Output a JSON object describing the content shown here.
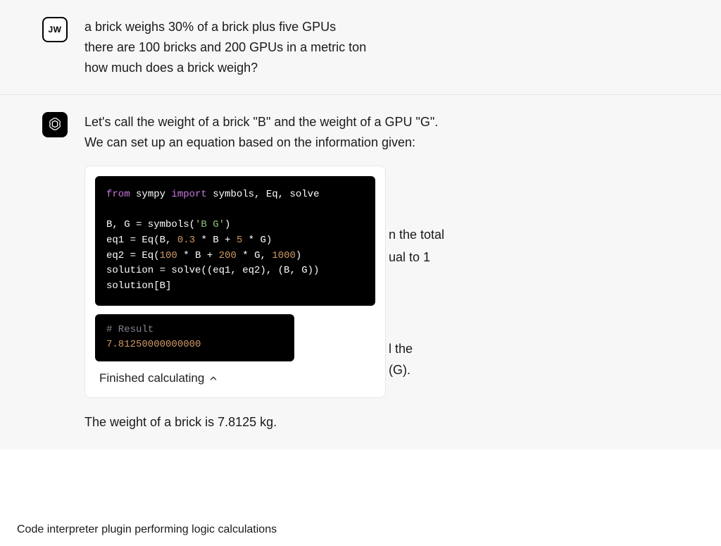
{
  "user": {
    "initials": "JW",
    "message_line1": "a brick weighs 30% of a brick plus five GPUs",
    "message_line2": "there are 100 bricks and 200 GPUs in a metric ton",
    "message_line3": "how much does a brick weigh?"
  },
  "assistant": {
    "intro": "Let's call the weight of a brick \"B\" and the weight of a GPU \"G\". We can set up an equation based on the information given:",
    "bg_fragments": {
      "f1": "n the total",
      "f2": "ual to 1",
      "f3": "l the",
      "f4": " (G)."
    },
    "code": {
      "kw_from": "from",
      "mod": " sympy ",
      "kw_import": "import",
      "imports": " symbols, Eq, solve",
      "line2a": "B, G = symbols(",
      "line2_str": "'B G'",
      "line2b": ")",
      "line3a": "eq1 = Eq(B, ",
      "n03": "0.3",
      "line3b": " * B + ",
      "n5": "5",
      "line3c": " * G)",
      "line4a": "eq2 = Eq(",
      "n100": "100",
      "line4b": " * B + ",
      "n200": "200",
      "line4c": " * G, ",
      "n1000": "1000",
      "line4d": ")",
      "line5": "solution = solve((eq1, eq2), (B, G))",
      "line6": "solution[B]"
    },
    "result": {
      "comment": "# Result",
      "value": "7.81250000000000"
    },
    "status": "Finished calculating",
    "final": "The weight of a brick is 7.8125 kg."
  },
  "caption": "Code interpreter plugin performing logic calculations"
}
